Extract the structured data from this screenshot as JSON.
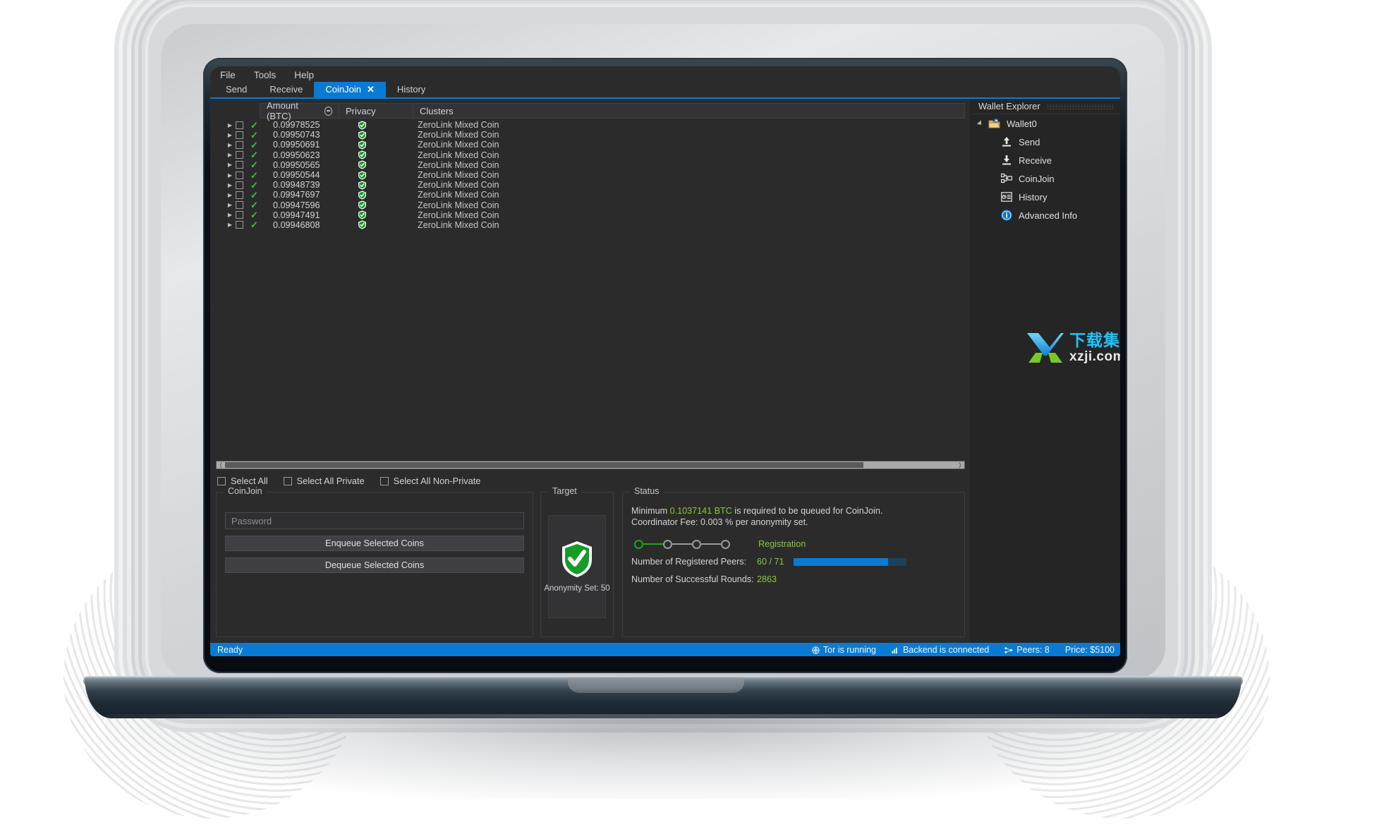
{
  "app": {
    "menu": [
      "File",
      "Tools",
      "Help"
    ],
    "tabs": [
      {
        "label": "Send",
        "active": false,
        "closable": false
      },
      {
        "label": "Receive",
        "active": false,
        "closable": false
      },
      {
        "label": "CoinJoin",
        "active": true,
        "closable": true,
        "close_glyph": "✕"
      },
      {
        "label": "History",
        "active": false,
        "closable": false
      }
    ],
    "accent_color": "#0a7bd4"
  },
  "coin_table": {
    "columns": [
      "Amount (BTC)",
      "Privacy",
      "Clusters"
    ],
    "sort_icon": "circle-minus-icon",
    "rows": [
      {
        "amount": "0.09978525",
        "cluster": "ZeroLink Mixed Coin"
      },
      {
        "amount": "0.09950743",
        "cluster": "ZeroLink Mixed Coin"
      },
      {
        "amount": "0.09950691",
        "cluster": "ZeroLink Mixed Coin"
      },
      {
        "amount": "0.09950623",
        "cluster": "ZeroLink Mixed Coin"
      },
      {
        "amount": "0.09950565",
        "cluster": "ZeroLink Mixed Coin"
      },
      {
        "amount": "0.09950544",
        "cluster": "ZeroLink Mixed Coin"
      },
      {
        "amount": "0.09948739",
        "cluster": "ZeroLink Mixed Coin"
      },
      {
        "amount": "0.09947697",
        "cluster": "ZeroLink Mixed Coin"
      },
      {
        "amount": "0.09947596",
        "cluster": "ZeroLink Mixed Coin"
      },
      {
        "amount": "0.09947491",
        "cluster": "ZeroLink Mixed Coin"
      },
      {
        "amount": "0.09946808",
        "cluster": "ZeroLink Mixed Coin"
      }
    ]
  },
  "watermark": {
    "cn_text": "下载集",
    "url_text": "xzji.com"
  },
  "select_row": {
    "select_all": "Select All",
    "select_all_private": "Select All Private",
    "select_all_non_private": "Select All Non-Private"
  },
  "coinjoin_panel": {
    "legend": "CoinJoin",
    "password_placeholder": "Password",
    "password_value": "",
    "enqueue_label": "Enqueue Selected Coins",
    "dequeue_label": "Dequeue Selected Coins"
  },
  "target_panel": {
    "legend": "Target",
    "icon": "green-shield-check-icon",
    "anonymity_text": "Anonymity Set: 50"
  },
  "status_panel": {
    "legend": "Status",
    "minimum_prefix": "Minimum ",
    "minimum_amount": "0.1037141 BTC",
    "minimum_suffix": " is required to be queued for CoinJoin.",
    "coordinator_fee": "Coordinator Fee: 0.003 % per anonymity set.",
    "phase_label": "Registration",
    "phase_index": 0,
    "phase_count": 4,
    "registered_peers_label": "Number of Registered Peers:",
    "registered_peers_value": "60 / 71",
    "registered_peers_pct": 84,
    "successful_rounds_label": "Number of Successful Rounds:",
    "successful_rounds_value": "2863"
  },
  "wallet_explorer": {
    "title": "Wallet Explorer",
    "root": {
      "label": "Wallet0",
      "icon": "wallet-folder-icon"
    },
    "items": [
      {
        "label": "Send",
        "icon": "upload-arrow-icon"
      },
      {
        "label": "Receive",
        "icon": "download-arrow-icon"
      },
      {
        "label": "CoinJoin",
        "icon": "coinjoin-nodes-icon"
      },
      {
        "label": "History",
        "icon": "history-list-icon"
      },
      {
        "label": "Advanced Info",
        "icon": "info-circle-icon"
      }
    ]
  },
  "status_bar": {
    "ready": "Ready",
    "tor": "Tor is running",
    "backend": "Backend is connected",
    "peers": "Peers: 8",
    "price": "Price: $5100"
  }
}
